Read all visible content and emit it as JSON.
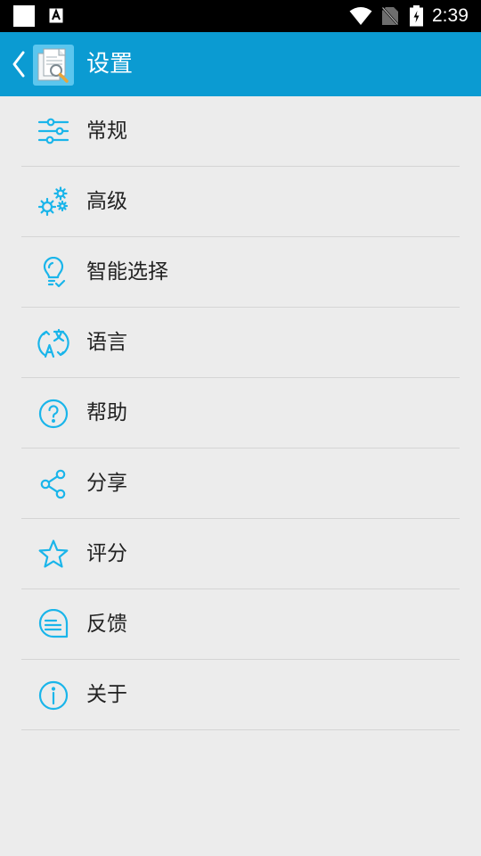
{
  "status_bar": {
    "time": "2:39"
  },
  "app_bar": {
    "title": "设置"
  },
  "menu": {
    "items": [
      {
        "label": "常规",
        "icon": "sliders-icon"
      },
      {
        "label": "高级",
        "icon": "gears-icon"
      },
      {
        "label": "智能选择",
        "icon": "lightbulb-check-icon"
      },
      {
        "label": "语言",
        "icon": "translate-icon"
      },
      {
        "label": "帮助",
        "icon": "help-circle-icon"
      },
      {
        "label": "分享",
        "icon": "share-icon"
      },
      {
        "label": "评分",
        "icon": "star-icon"
      },
      {
        "label": "反馈",
        "icon": "feedback-bubble-icon"
      },
      {
        "label": "关于",
        "icon": "info-icon"
      }
    ]
  },
  "colors": {
    "app_bar": "#0b9bd2",
    "icon_accent": "#1ab5ea",
    "background": "#ececec"
  }
}
